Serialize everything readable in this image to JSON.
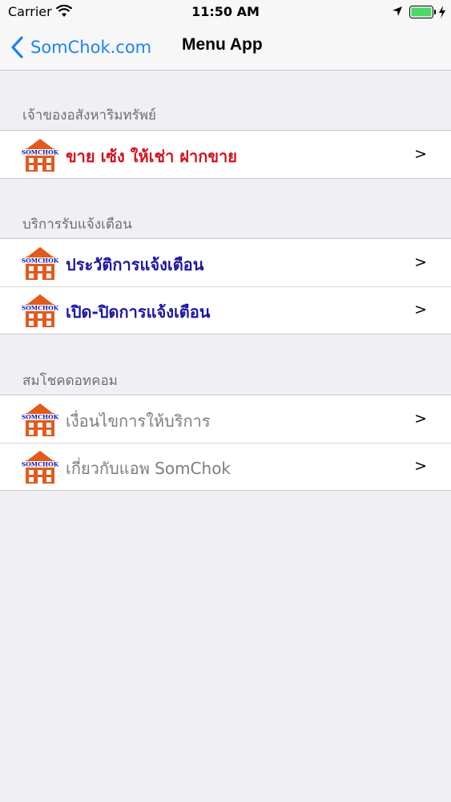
{
  "status_bar": {
    "carrier": "Carrier",
    "time": "11:50 AM",
    "battery_color": "#4cd964"
  },
  "nav": {
    "back_label": "SomChok.com",
    "title": "Menu App",
    "accent": "#1a82fb"
  },
  "sections": [
    {
      "header": "เจ้าของอสังหาริมทรัพย์",
      "items": [
        {
          "label": "ขาย เซ้ง ให้เช่า ฝากขาย",
          "chevron": ">",
          "color": "#d4111b"
        }
      ]
    },
    {
      "header": "บริการรับแจ้งเตือน",
      "items": [
        {
          "label": "ประวัติการแจ้งเตือน",
          "chevron": ">",
          "color": "#1c16a6"
        },
        {
          "label": "เปิด-ปิดการแจ้งเตือน",
          "chevron": ">",
          "color": "#1c16a6"
        }
      ]
    },
    {
      "header": "สมโชคดอทคอม",
      "items": [
        {
          "label": "เงื่อนไขการให้บริการ",
          "chevron": ">",
          "color": "#7d7d82"
        },
        {
          "label": "เกี่ยวกับแอพ SomChok",
          "chevron": ">",
          "color": "#7d7d82"
        }
      ]
    }
  ],
  "logo_text": "SOMCHOK"
}
